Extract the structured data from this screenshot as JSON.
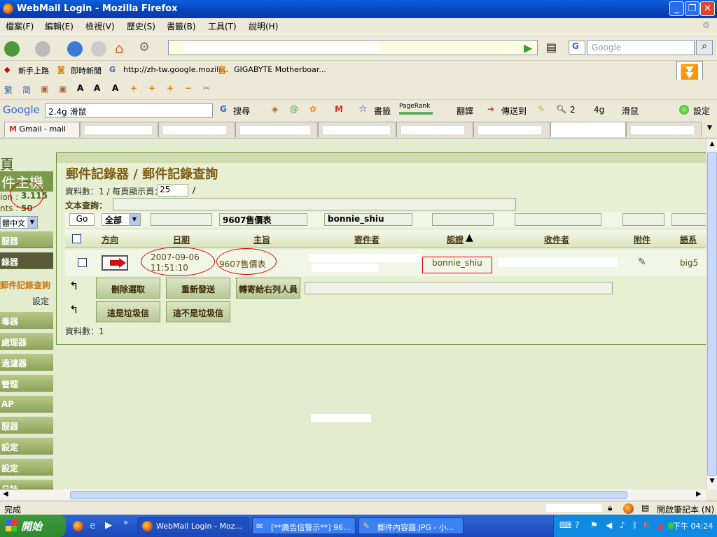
{
  "window": {
    "title": "WebMail Login - Mozilla Firefox"
  },
  "menu": [
    "檔案(F)",
    "編輯(E)",
    "檢視(V)",
    "歷史(S)",
    "書籤(B)",
    "工具(T)",
    "說明(H)"
  ],
  "navbar": {
    "search_placeholder": "Google"
  },
  "bookmarks": [
    "新手上路",
    "即時新聞",
    "http://zh-tw.google.mozill...",
    "GIGABYTE Motherboar..."
  ],
  "googlebar": {
    "logo": "Google",
    "query": "2.4g 滑鼠",
    "search_label": "搜尋",
    "bookmarks_label": "書籤",
    "pagerank_label": "PageRank",
    "translate_label": "翻譯",
    "send_label": "傳送到",
    "term_count": "2",
    "term1": "4g",
    "term2": "滑鼠",
    "settings_label": "設定"
  },
  "tabs": [
    {
      "label": "Gmail - mail"
    }
  ],
  "sidebar": {
    "brand_char": "頁",
    "brand_title": "件主機",
    "version_label": "ion :",
    "version": "3.115",
    "accounts_label": "nts :",
    "accounts": "50",
    "language": "體中文",
    "items": [
      "服器",
      "錄器",
      "郵件記錄查詢",
      "設定",
      "毒器",
      "處理器",
      "過濾器",
      "管理",
      "AP",
      "服器",
      "設定",
      "設定",
      "日誌"
    ]
  },
  "main": {
    "breadcrumb": "郵件記錄器 / 郵件記錄查詢",
    "records_label": "資料數：1 / 每頁顯示頁：",
    "per_page": "25",
    "slash": "/",
    "text_query_label": "文本查詢：",
    "go_label": "Go",
    "direction_filter": "全部",
    "subject_filter": "9607售價表",
    "sender_filter": "bonnie_shiu",
    "columns": [
      "方向",
      "日期",
      "主旨",
      "寄件者",
      "認證",
      "收件者",
      "附件",
      "語系"
    ],
    "row": {
      "date": "2007-09-06",
      "time": "11:51:10",
      "subject": "9607售價表",
      "auth": "bonnie_shiu",
      "charset": "big5"
    },
    "buttons": {
      "delete_selected": "刪除選取",
      "resend": "重新發送",
      "forward": "轉寄給右列人員",
      "is_spam": "這是垃圾信",
      "not_spam": "這不是垃圾信"
    },
    "footer_records": "資料數：1"
  },
  "status": {
    "text": "完成",
    "notepad": "開啟筆記本 (N)"
  },
  "taskbar": {
    "start": "開始",
    "items": [
      "WebMail Login - Moz...",
      "[**廣告信警示**] 96...",
      "郵件內容圖.JPG - 小..."
    ],
    "time": "下午 04:24"
  }
}
